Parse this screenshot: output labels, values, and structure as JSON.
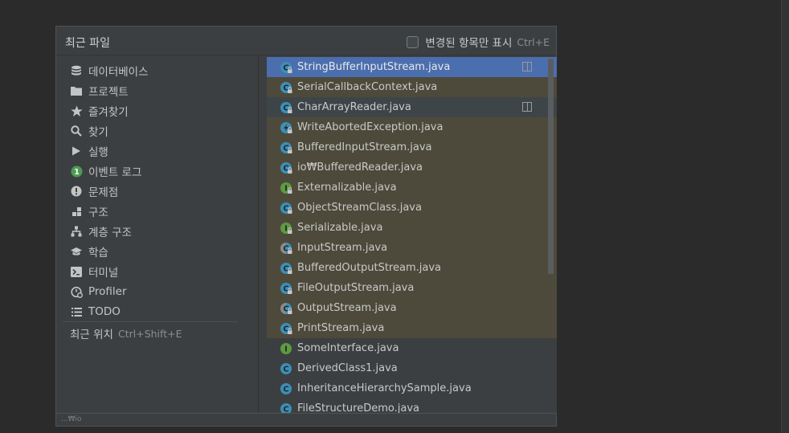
{
  "popup": {
    "title": "최근 파일",
    "filter_label": "변경된 항목만 표시",
    "filter_shortcut": "Ctrl+E",
    "filter_checked": false
  },
  "nav": [
    {
      "label": "데이터베이스",
      "icon": "database-icon"
    },
    {
      "label": "프로젝트",
      "icon": "folder-icon"
    },
    {
      "label": "즐겨찾기",
      "icon": "star-icon"
    },
    {
      "label": "찾기",
      "icon": "search-icon"
    },
    {
      "label": "실행",
      "icon": "run-icon"
    },
    {
      "label": "이벤트 로그",
      "icon": "event-log-badge-icon",
      "badge": "1"
    },
    {
      "label": "문제점",
      "icon": "problems-icon"
    },
    {
      "label": "구조",
      "icon": "structure-icon"
    },
    {
      "label": "계층 구조",
      "icon": "hierarchy-icon"
    },
    {
      "label": "학습",
      "icon": "learn-icon"
    },
    {
      "label": "터미널",
      "icon": "terminal-icon"
    },
    {
      "label": "Profiler",
      "icon": "profiler-icon"
    },
    {
      "label": "TODO",
      "icon": "todo-list-icon"
    }
  ],
  "recent_locations": {
    "label": "최근 위치",
    "shortcut": "Ctrl+Shift+E"
  },
  "files": [
    {
      "name": "StringBufferInputStream.java",
      "kind": "class-locked",
      "state": "selected",
      "split": true
    },
    {
      "name": "SerialCallbackContext.java",
      "kind": "class-locked",
      "state": "modified"
    },
    {
      "name": "CharArrayReader.java",
      "kind": "class-locked",
      "state": "hover",
      "split": true
    },
    {
      "name": "WriteAbortedException.java",
      "kind": "exception-locked",
      "state": "modified"
    },
    {
      "name": "BufferedInputStream.java",
      "kind": "class-locked",
      "state": "modified"
    },
    {
      "name": "io₩BufferedReader.java",
      "kind": "class-locked",
      "state": "modified"
    },
    {
      "name": "Externalizable.java",
      "kind": "interface-locked",
      "state": "modified"
    },
    {
      "name": "ObjectStreamClass.java",
      "kind": "class-locked",
      "state": "modified"
    },
    {
      "name": "Serializable.java",
      "kind": "interface-locked",
      "state": "modified"
    },
    {
      "name": "InputStream.java",
      "kind": "abstract-locked",
      "state": "modified"
    },
    {
      "name": "BufferedOutputStream.java",
      "kind": "class-locked",
      "state": "modified"
    },
    {
      "name": "FileOutputStream.java",
      "kind": "class-locked",
      "state": "modified"
    },
    {
      "name": "OutputStream.java",
      "kind": "abstract-locked",
      "state": "modified"
    },
    {
      "name": "PrintStream.java",
      "kind": "class-locked",
      "state": "modified"
    },
    {
      "name": "SomeInterface.java",
      "kind": "interface",
      "state": "normal"
    },
    {
      "name": "DerivedClass1.java",
      "kind": "class",
      "state": "normal"
    },
    {
      "name": "InheritanceHierarchySample.java",
      "kind": "class",
      "state": "normal"
    },
    {
      "name": "FileStructureDemo.java",
      "kind": "class",
      "state": "normal"
    }
  ],
  "footer": {
    "path": "...₩io"
  },
  "colors": {
    "selected": "#4b6eaf",
    "modified": "#4d4a3b",
    "class_icon": "#3d8fb5",
    "interface_icon": "#5e9a3f"
  }
}
